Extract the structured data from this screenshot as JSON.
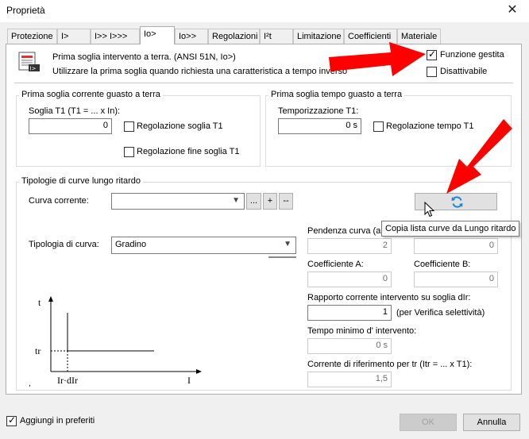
{
  "window": {
    "title": "Proprietà",
    "close_symbol": "✕"
  },
  "tabs": [
    "Protezione",
    "I>",
    "I>> I>>>",
    "Io>",
    "Io>>",
    "Regolazioni",
    "I²t",
    "Limitazione",
    "Coefficienti",
    "Materiale"
  ],
  "header": {
    "line1": "Prima soglia intervento a terra. (ANSI 51N, Io>)",
    "line2": "Utilizzare la prima soglia quando richiesta una caratteristica a tempo inverso",
    "funzione_gestita_label": "Funzione gestita",
    "funzione_gestita_checked": true,
    "disattivabile_label": "Disattivabile",
    "disattivabile_checked": false
  },
  "group_soglia_corrente": {
    "title": "Prima soglia corrente guasto a terra",
    "soglia_label": "Soglia T1 (T1 = ... x In):",
    "soglia_value": "0",
    "regolazione_soglia_label": "Regolazione soglia T1",
    "regolazione_fine_label": "Regolazione fine soglia T1"
  },
  "group_soglia_tempo": {
    "title": "Prima soglia tempo guasto a terra",
    "temporizzazione_label": "Temporizzazione T1:",
    "temporizzazione_value": "0 s",
    "regolazione_tempo_label": "Regolazione tempo T1"
  },
  "group_curve": {
    "title": "Tipologie di curve lungo ritardo",
    "curva_corrente_label": "Curva corrente:",
    "curva_corrente_value": "",
    "btn_more": "...",
    "btn_plus": "+",
    "btn_minus": "--",
    "tooltip": "Copia lista curve da Lungo ritardo",
    "tipologia_label": "Tipologia di curva:",
    "tipologia_value": "Gradino",
    "pendenza_label": "Pendenza curva (al",
    "pendenza_value": "2",
    "right_top_value": "0",
    "coeff_a_label": "Coefficiente A:",
    "coeff_a_value": "0",
    "coeff_b_label": "Coefficiente B:",
    "coeff_b_value": "0",
    "rapporto_label": "Rapporto corrente intervento su soglia dIr:",
    "rapporto_value": "1",
    "rapporto_note": "(per Verifica selettività)",
    "tempo_min_label": "Tempo minimo d' intervento:",
    "tempo_min_value": "0 s",
    "corrente_rif_label": "Corrente di riferimento per tr (Itr = ... x T1):",
    "corrente_rif_value": "1,5"
  },
  "graph": {
    "t_label": "t",
    "tr_label": "tr",
    "x_tick_label": "Ir·dIr",
    "i_label": "I",
    "corner_mark": ","
  },
  "footer": {
    "preferiti_label": "Aggiungi in preferiti",
    "preferiti_checked": true,
    "ok_label": "OK",
    "annulla_label": "Annulla"
  },
  "colors": {
    "arrow_red": "#ff0000",
    "refresh_blue": "#1a86d8"
  }
}
